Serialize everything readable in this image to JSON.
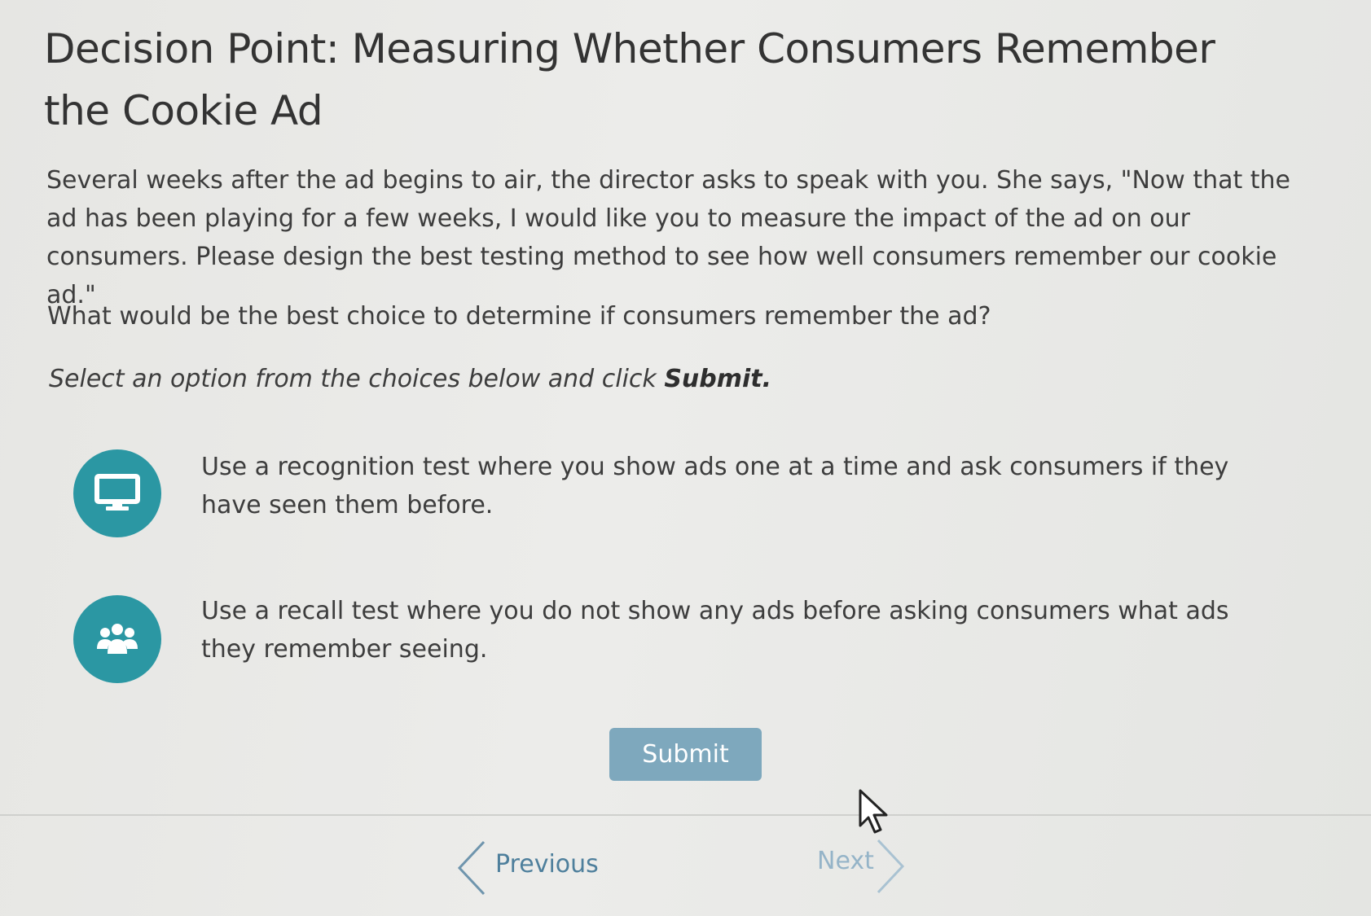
{
  "title": "Decision Point: Measuring Whether Consumers Remember the Cookie Ad",
  "scenario": "Several weeks after the ad begins to air, the director asks to speak with you. She says, \"Now that the ad has been playing for a few weeks, I would like you to measure the impact of the ad on our consumers. Please design the best testing method to see how well consumers remember our cookie ad.\"",
  "question": "What would be the best choice to determine if consumers remember the ad?",
  "instruction": {
    "prefix": "Select an option from the choices below and click ",
    "emphasis": "Submit."
  },
  "options": [
    {
      "icon": "monitor-icon",
      "text": "Use a recognition test where you show ads one at a time and ask consumers if they have seen them before."
    },
    {
      "icon": "group-icon",
      "text": "Use a recall test where you do not show any ads before asking consumers what ads they remember seeing."
    }
  ],
  "submit_label": "Submit",
  "nav": {
    "previous_label": "Previous",
    "next_label": "Next"
  },
  "colors": {
    "accent": "#2b97a3",
    "submit_bg": "#7ea8bd",
    "link": "#4e7f9c",
    "link_disabled": "#95b4c8"
  }
}
